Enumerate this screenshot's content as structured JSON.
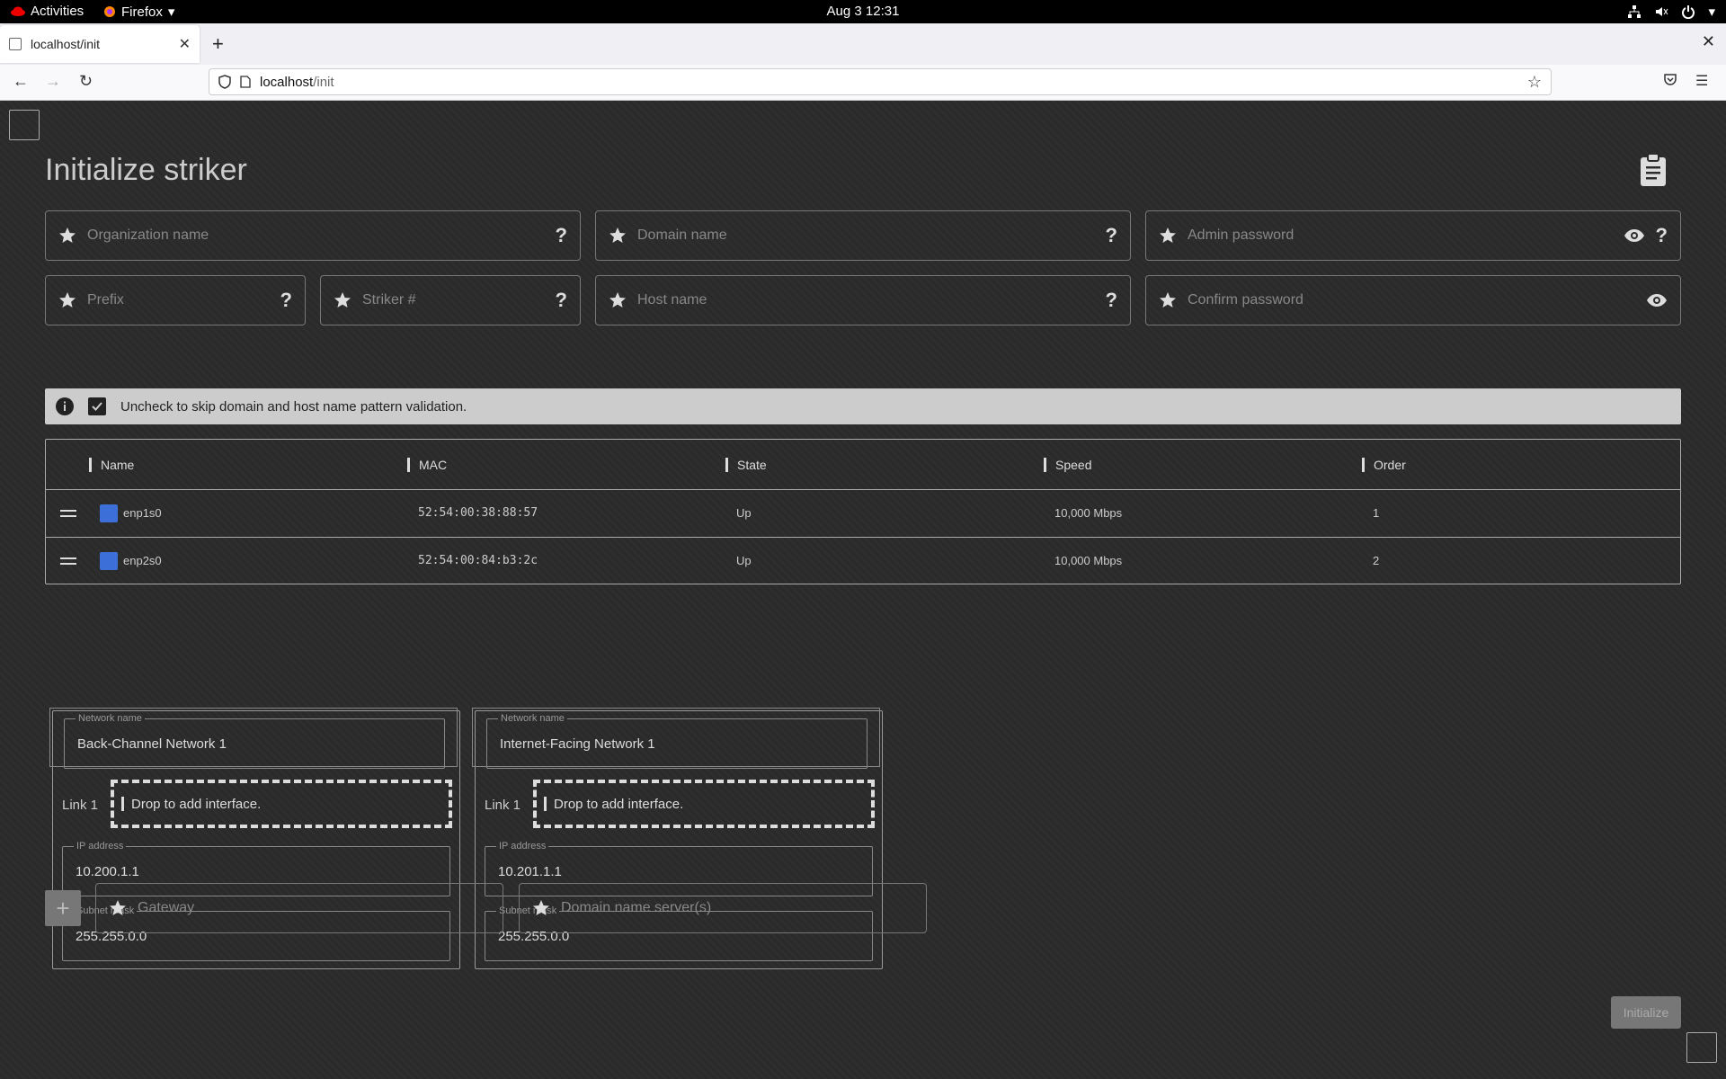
{
  "system": {
    "activities": "Activities",
    "browser_menu": "Firefox",
    "clock": "Aug 3  12:31"
  },
  "browser": {
    "tab_title": "localhost/init",
    "url_host": "localhost",
    "url_path": "/init"
  },
  "page": {
    "title": "Initialize striker",
    "fields": {
      "organization_name": "Organization name",
      "domain_name": "Domain name",
      "admin_password": "Admin password",
      "prefix": "Prefix",
      "striker_number": "Striker #",
      "host_name": "Host name",
      "confirm_password": "Confirm password"
    },
    "info_text": "Uncheck to skip domain and host name pattern validation.",
    "table": {
      "headers": [
        "Name",
        "MAC",
        "State",
        "Speed",
        "Order"
      ],
      "rows": [
        {
          "name": "enp1s0",
          "mac": "52:54:00:38:88:57",
          "state": "Up",
          "speed": "10,000 Mbps",
          "order": "1"
        },
        {
          "name": "enp2s0",
          "mac": "52:54:00:84:b3:2c",
          "state": "Up",
          "speed": "10,000 Mbps",
          "order": "2"
        }
      ]
    },
    "networks": [
      {
        "name_label": "Network name",
        "name": "Back-Channel Network 1",
        "link_label": "Link 1",
        "drop_text": "Drop to add interface.",
        "ip_label": "IP address",
        "ip": "10.200.1.1",
        "mask_label": "Subnet mask",
        "mask": "255.255.0.0"
      },
      {
        "name_label": "Network name",
        "name": "Internet-Facing Network 1",
        "link_label": "Link 1",
        "drop_text": "Drop to add interface.",
        "ip_label": "IP address",
        "ip": "10.201.1.1",
        "mask_label": "Subnet mask",
        "mask": "255.255.0.0"
      }
    ],
    "gateway": "Gateway",
    "dns": "Domain name server(s)",
    "add_label": "+",
    "initialize_label": "Initialize"
  },
  "colors": {
    "background": "#2c2c2c",
    "info_bar": "#cccccc",
    "interface_icon": "#3c6fd8",
    "disabled_button": "#777777"
  }
}
